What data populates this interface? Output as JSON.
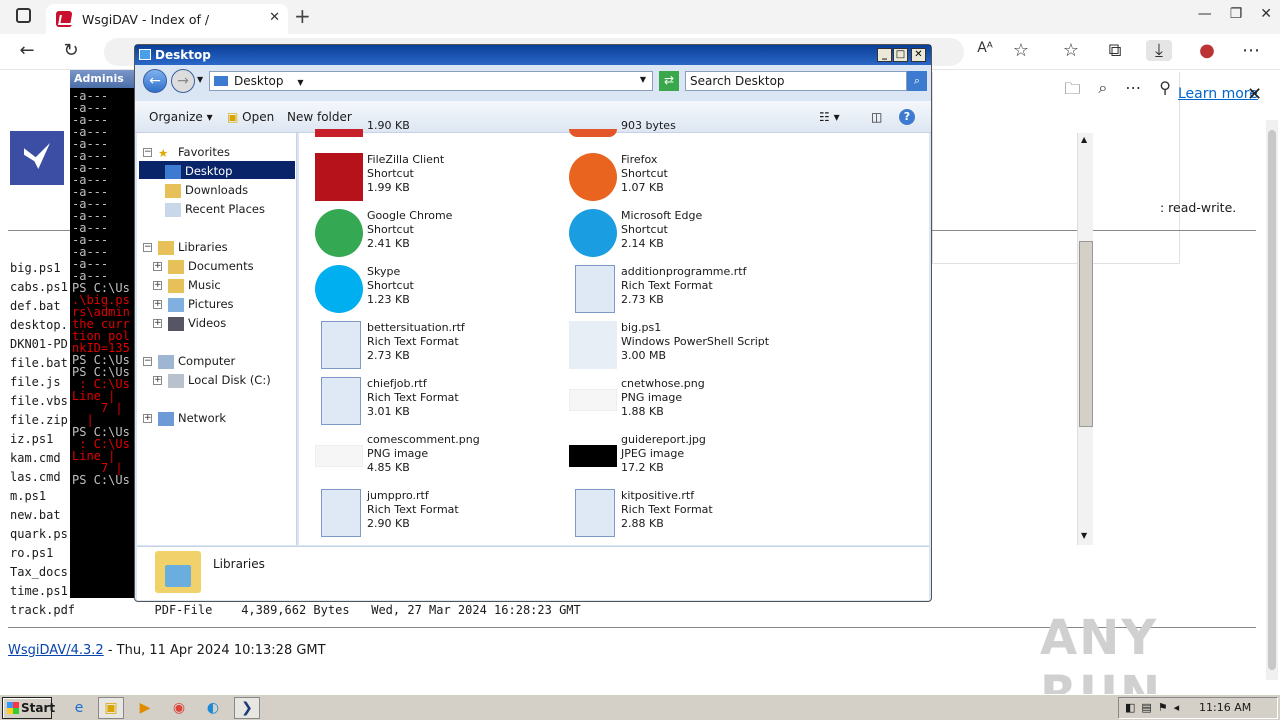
{
  "browser": {
    "tab_title": "WsgiDAV - Index of /",
    "tab_close": "✕",
    "new_tab": "+",
    "learn_more": "Learn more",
    "side_text": ": read-write."
  },
  "page": {
    "files": [
      "big.ps1",
      "cabs.ps1",
      "def.bat",
      "desktop.",
      "DKN01-PD",
      "file.bat",
      "file.js",
      "file.vbs",
      "file.zip",
      "iz.ps1",
      "kam.cmd",
      "las.cmd",
      "m.ps1",
      "new.bat",
      "quark.ps",
      "ro.ps1",
      "Tax_docs",
      "time.ps1"
    ],
    "track_row": "track.pdf           PDF-File    4,389,662 Bytes   Wed, 27 Mar 2024 16:28:23 GMT",
    "footer_link": "WsgiDAV/4.3.2",
    "footer_text": " - Thu, 11 Apr 2024 10:13:28 GMT",
    "watermark": "ANY RUN"
  },
  "powershell": {
    "title": "Adminis",
    "lines": [
      "-a---",
      "-a---",
      "-a---",
      "-a---",
      "-a---",
      "-a---",
      "-a---",
      "-a---",
      "-a---",
      "-a---",
      "-a---",
      "-a---",
      "-a---",
      "-a---",
      "-a---",
      "-a---",
      "PS C:\\Us",
      "PS C:\\Us",
      "PS C:\\Us",
      "PS C:\\Us",
      "PS C:\\Us"
    ],
    "red_lines": [
      ".\\big.ps",
      "rs\\admin",
      "the curr",
      "tion pol",
      "nkID=135",
      " : C:\\Us",
      "Line |",
      "    7 |",
      "  |",
      " : C:\\Us",
      "Line |",
      "    7 |"
    ]
  },
  "explorer": {
    "title": "Desktop",
    "breadcrumb": "Desktop",
    "search_placeholder": "Search Desktop",
    "commands": {
      "organize": "Organize",
      "open": "Open",
      "new_folder": "New folder"
    },
    "nav": {
      "favorites": "Favorites",
      "desktop": "Desktop",
      "downloads": "Downloads",
      "recent": "Recent Places",
      "libraries": "Libraries",
      "documents": "Documents",
      "music": "Music",
      "pictures": "Pictures",
      "videos": "Videos",
      "computer": "Computer",
      "local_disk": "Local Disk (C:)",
      "network": "Network"
    },
    "top_sizes": [
      "1.90 KB",
      "903 bytes"
    ],
    "items": [
      {
        "name": "FileZilla Client",
        "type": "Shortcut",
        "size": "1.99 KB",
        "icon": "filezilla-icon"
      },
      {
        "name": "Firefox",
        "type": "Shortcut",
        "size": "1.07 KB",
        "icon": "firefox-icon"
      },
      {
        "name": "Google Chrome",
        "type": "Shortcut",
        "size": "2.41 KB",
        "icon": "chrome-icon"
      },
      {
        "name": "Microsoft Edge",
        "type": "Shortcut",
        "size": "2.14 KB",
        "icon": "edge-icon"
      },
      {
        "name": "Skype",
        "type": "Shortcut",
        "size": "1.23 KB",
        "icon": "skype-icon"
      },
      {
        "name": "additionprogramme.rtf",
        "type": "Rich Text Format",
        "size": "2.73 KB",
        "icon": "word-doc-icon"
      },
      {
        "name": "bettersituation.rtf",
        "type": "Rich Text Format",
        "size": "2.73 KB",
        "icon": "word-doc-icon"
      },
      {
        "name": "big.ps1",
        "type": "Windows PowerShell Script",
        "size": "3.00 MB",
        "icon": "powershell-script-icon"
      },
      {
        "name": "chiefjob.rtf",
        "type": "Rich Text Format",
        "size": "3.01 KB",
        "icon": "word-doc-icon"
      },
      {
        "name": "cnetwhose.png",
        "type": "PNG image",
        "size": "1.88 KB",
        "icon": "png-thumbnail-icon"
      },
      {
        "name": "comescomment.png",
        "type": "PNG image",
        "size": "4.85 KB",
        "icon": "png-thumbnail-icon"
      },
      {
        "name": "guidereport.jpg",
        "type": "JPEG image",
        "size": "17.2 KB",
        "icon": "jpg-thumbnail-icon"
      },
      {
        "name": "jumppro.rtf",
        "type": "Rich Text Format",
        "size": "2.90 KB",
        "icon": "word-doc-icon"
      },
      {
        "name": "kitpositive.rtf",
        "type": "Rich Text Format",
        "size": "2.88 KB",
        "icon": "word-doc-icon"
      }
    ],
    "details_label": "Libraries"
  },
  "taskbar": {
    "start": "Start",
    "clock": "11:16 AM"
  }
}
